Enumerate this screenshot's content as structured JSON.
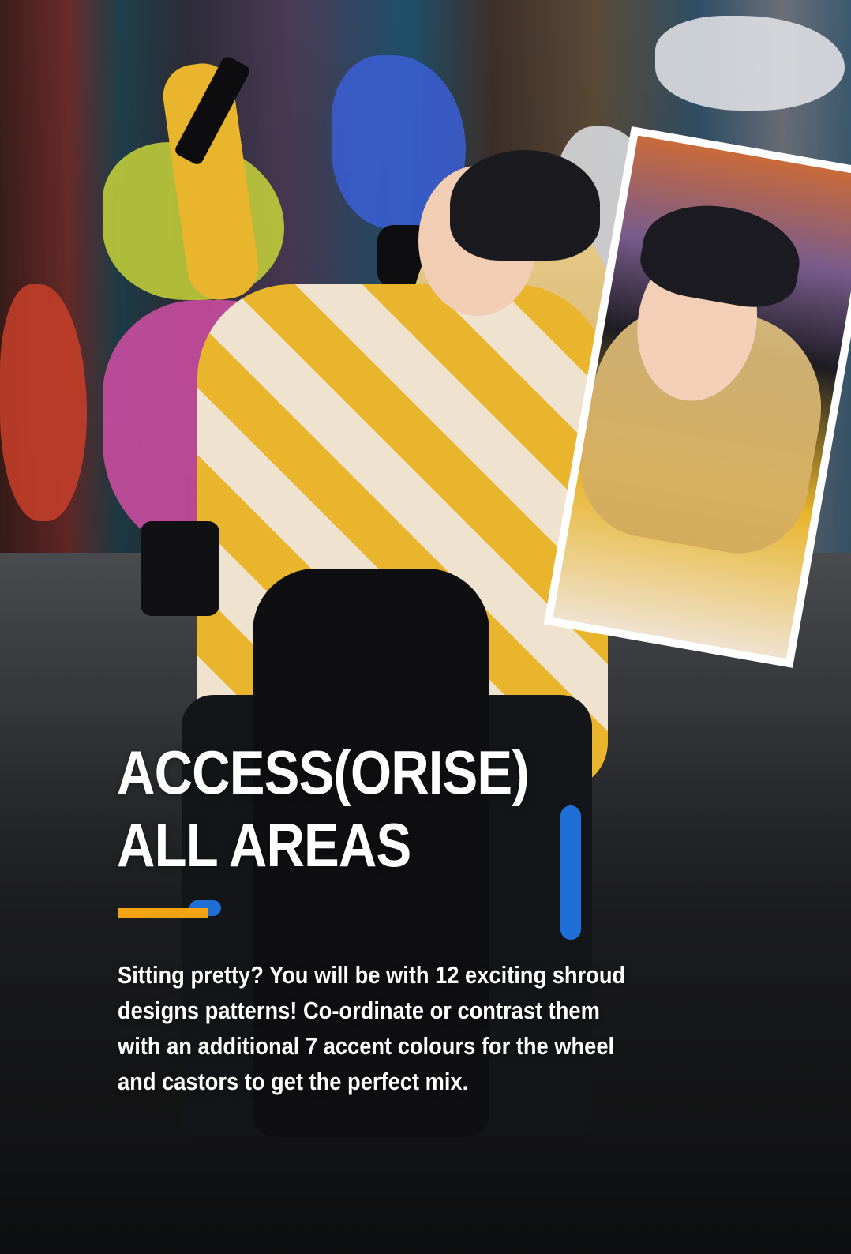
{
  "headline": {
    "line1": "ACCESS(ORISE)",
    "line2": "ALL AREAS"
  },
  "body": {
    "line1": "Sitting pretty? You will be with 12 exciting shroud",
    "line2": "designs patterns! Co-ordinate or contrast them",
    "line3": "with an additional 7 accent colours for the wheel",
    "line4": "and castors to get the perfect mix."
  },
  "colors": {
    "accent": "#F5A313",
    "text": "#FFFFFF"
  }
}
